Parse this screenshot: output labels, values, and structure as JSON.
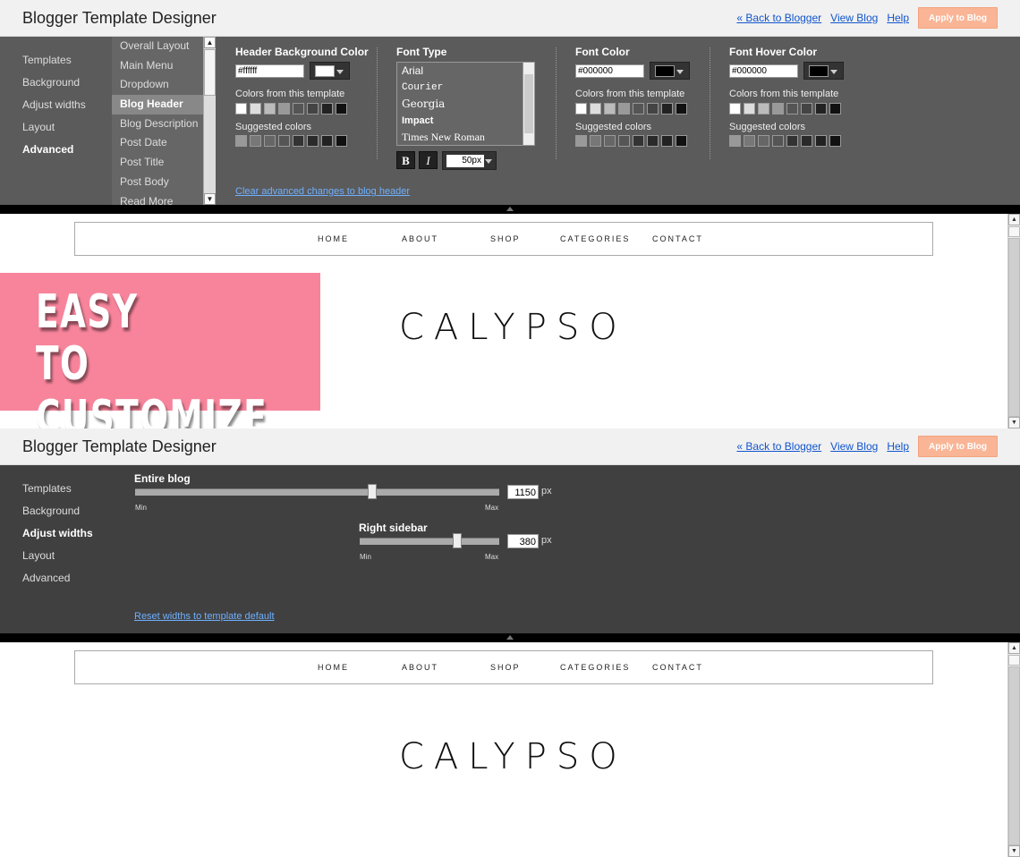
{
  "app_title": "Blogger Template Designer",
  "links": {
    "back": "« Back to Blogger",
    "view": "View Blog",
    "help": "Help",
    "apply": "Apply to Blog"
  },
  "nav": [
    "Templates",
    "Background",
    "Adjust widths",
    "Layout",
    "Advanced"
  ],
  "advanced_items": [
    "Overall Layout",
    "Main Menu",
    "Dropdown",
    "Blog Header",
    "Blog Description",
    "Post Date",
    "Post Title",
    "Post Body",
    "Read More"
  ],
  "header_bg": {
    "title": "Header Background Color",
    "hex": "#ffffff",
    "swatch": "#ffffff"
  },
  "font_type": {
    "title": "Font Type",
    "fonts": [
      "Arial",
      "Courier",
      "Georgia",
      "Impact",
      "Times New Roman"
    ],
    "bold": "B",
    "italic": "I",
    "size": "50px"
  },
  "font_color": {
    "title": "Font Color",
    "hex": "#000000",
    "swatch": "#000000"
  },
  "font_hover": {
    "title": "Font Hover Color",
    "hex": "#000000",
    "swatch": "#000000"
  },
  "colors_from_template": "Colors from this template",
  "suggested_colors": "Suggested colors",
  "clear_link": "Clear advanced changes to blog header",
  "blog_nav": [
    "HOME",
    "ABOUT",
    "SHOP",
    "CATEGORIES",
    "CONTACT"
  ],
  "logo": "CALYPSO",
  "promo": {
    "line1": "EASY",
    "line2": "TO CUSTOMIZE",
    "color": "#f7849b"
  },
  "widths": {
    "entire_label": "Entire blog",
    "entire_value": "1150",
    "entire_level": 0.65,
    "sidebar_label": "Right sidebar",
    "sidebar_value": "380",
    "sidebar_level": 0.7,
    "unit": "px",
    "min": "Min",
    "max": "Max",
    "reset_link": "Reset widths to template default"
  },
  "colors": {
    "accent": "#f9b596",
    "link": "#1155cc",
    "panel_dark": "#404040",
    "panel_mid": "#5b5b5b"
  }
}
